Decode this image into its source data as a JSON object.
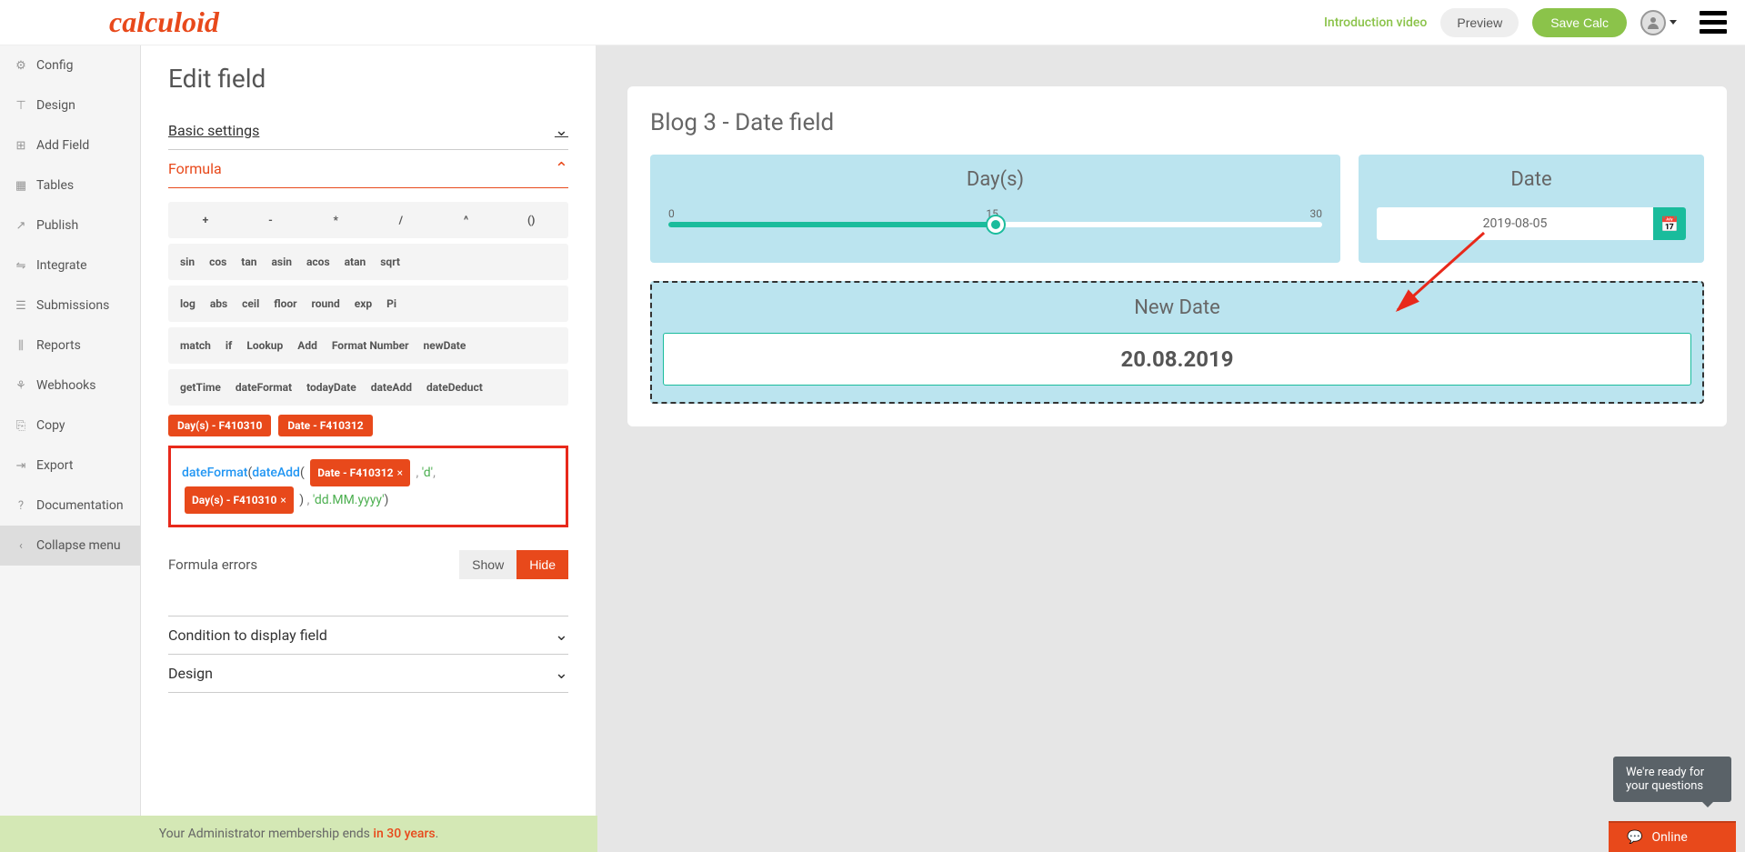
{
  "header": {
    "logo": "calculoid",
    "intro_link": "Introduction video",
    "preview_btn": "Preview",
    "save_btn": "Save Calc"
  },
  "sidebar": {
    "items": [
      {
        "icon": "⚙",
        "label": "Config"
      },
      {
        "icon": "⊤",
        "label": "Design"
      },
      {
        "icon": "⊞",
        "label": "Add Field"
      },
      {
        "icon": "▦",
        "label": "Tables"
      },
      {
        "icon": "↗",
        "label": "Publish"
      },
      {
        "icon": "⇋",
        "label": "Integrate"
      },
      {
        "icon": "☰",
        "label": "Submissions"
      },
      {
        "icon": "⫼",
        "label": "Reports"
      },
      {
        "icon": "⚘",
        "label": "Webhooks"
      },
      {
        "icon": "⎘",
        "label": "Copy"
      },
      {
        "icon": "⇥",
        "label": "Export"
      },
      {
        "icon": "?",
        "label": "Documentation"
      },
      {
        "icon": "‹",
        "label": "Collapse menu"
      }
    ]
  },
  "editor": {
    "title": "Edit field",
    "sections": {
      "basic": "Basic settings",
      "formula": "Formula",
      "condition": "Condition to display field",
      "design": "Design"
    },
    "operators": [
      "+",
      "-",
      "*",
      "/",
      "^",
      "()"
    ],
    "functions_row1": [
      "sin",
      "cos",
      "tan",
      "asin",
      "acos",
      "atan",
      "sqrt"
    ],
    "functions_row2": [
      "log",
      "abs",
      "ceil",
      "floor",
      "round",
      "exp",
      "Pi"
    ],
    "functions_row3": [
      "match",
      "if",
      "Lookup",
      "Add",
      "Format Number",
      "newDate"
    ],
    "functions_row4": [
      "getTime",
      "dateFormat",
      "todayDate",
      "dateAdd",
      "dateDeduct"
    ],
    "field_tags": [
      "Day(s) - F410310",
      "Date - F410312"
    ],
    "formula": {
      "f1": "dateFormat",
      "p1": "(",
      "f2": "dateAdd",
      "p2": "(",
      "t1": "Date - F410312",
      "c1": " ,",
      "s1": " 'd'",
      "c2": ",",
      "t2": "Day(s) - F410310",
      "p3": " )",
      "c3": " ,",
      "s2": " 'dd.MM.yyyy'",
      "p4": ")"
    },
    "errors_label": "Formula errors",
    "show_btn": "Show",
    "hide_btn": "Hide"
  },
  "preview": {
    "title": "Blog 3 - Date field",
    "days": {
      "title": "Day(s)",
      "min": "0",
      "mid": "15",
      "max": "30"
    },
    "date": {
      "title": "Date",
      "value": "2019-08-05"
    },
    "newdate": {
      "title": "New Date",
      "value": "20.08.2019"
    }
  },
  "footer": {
    "text": "Your Administrator membership ends ",
    "highlight": "in 30 years",
    "dot": "."
  },
  "chat": {
    "tooltip": "We're ready for your questions",
    "label": "Online"
  }
}
